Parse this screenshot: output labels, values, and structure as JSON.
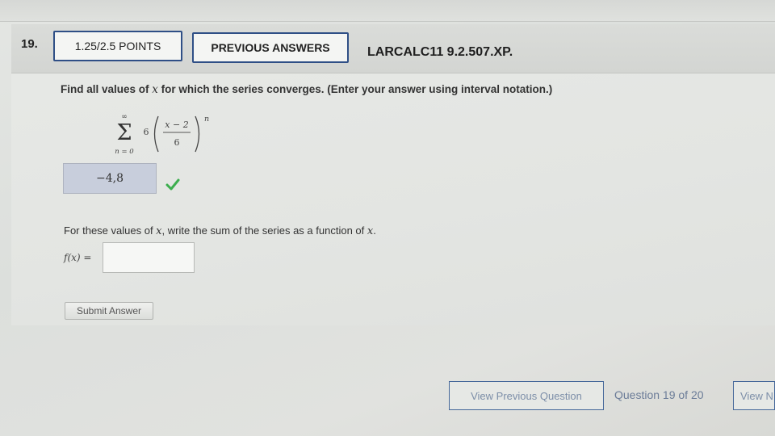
{
  "header": {
    "question_number": "19.",
    "points": "1.25/2.5 POINTS",
    "previous_answers": "PREVIOUS ANSWERS",
    "course_code": "LARCALC11 9.2.507.XP."
  },
  "question": {
    "prompt_before_var": "Find all values of ",
    "variable": "x",
    "prompt_after_var": " for which the series converges. (Enter your answer using interval notation.)",
    "series": {
      "upper_limit": "∞",
      "lower_limit": "n = 0",
      "coefficient": "6",
      "numerator": "x − 2",
      "denominator": "6",
      "exponent": "n"
    },
    "answer_value": "−4,8",
    "answer_status": "correct"
  },
  "sum_part": {
    "text_before_var": "For these values of ",
    "variable": "x",
    "text_middle": ", write the sum of the series as a function of ",
    "variable_end": "x",
    "text_end": ".",
    "fx_label": "f(x) =",
    "fx_value": ""
  },
  "buttons": {
    "submit": "Submit Answer",
    "view_previous": "View Previous Question",
    "view_next": "View N"
  },
  "navigation": {
    "progress": "Question 19 of 20"
  },
  "colors": {
    "accent_border": "#2f4f86",
    "check_green": "#3cae4e",
    "answer_fill": "#c8cedc"
  },
  "icons": {
    "check": "check-icon"
  }
}
